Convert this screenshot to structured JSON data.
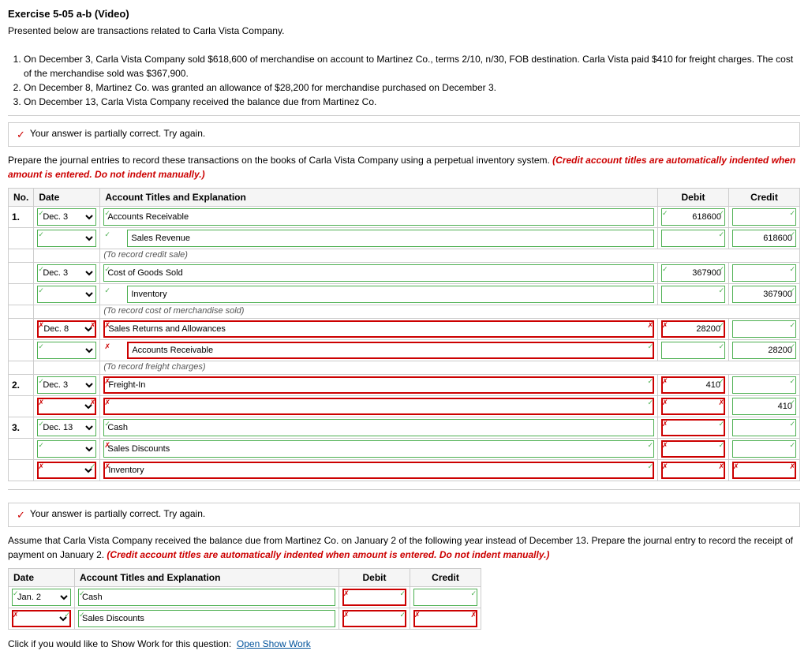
{
  "title": "Exercise 5-05 a-b (Video)",
  "intro": "Presented below are transactions related to Carla Vista Company.",
  "transactions": [
    "On December 3, Carla Vista Company sold $618,600 of merchandise on account to Martinez Co., terms 2/10, n/30, FOB destination. Carla Vista paid $410 for freight charges. The cost of the merchandise sold was $367,900.",
    "On December 8, Martinez Co. was granted an allowance of $28,200 for merchandise purchased on December 3.",
    "On December 13, Carla Vista Company received the balance due from Martinez Co."
  ],
  "alert": "Your answer is partially correct.  Try again.",
  "instruction_main": "Prepare the journal entries to record these transactions on the books of Carla Vista Company using a perpetual inventory system.",
  "instruction_red": "(Credit account titles are automatically indented when amount is entered. Do not indent manually.)",
  "table_headers": {
    "no": "No.",
    "date": "Date",
    "account": "Account Titles and Explanation",
    "debit": "Debit",
    "credit": "Credit"
  },
  "entries": [
    {
      "no": "1.",
      "rows": [
        {
          "date": "Dec. 3",
          "account": "Accounts Receivable",
          "debit": "618600",
          "credit": "",
          "date_state": "green",
          "acct_state": "green",
          "debit_state": "green",
          "credit_state": "green"
        },
        {
          "date": "",
          "account": "Sales Revenue",
          "debit": "",
          "credit": "618600",
          "acct_state": "green",
          "debit_state": "green",
          "credit_state": "green"
        },
        {
          "explanation": "(To record credit sale)"
        },
        {
          "date": "Dec. 3",
          "account": "Cost of Goods Sold",
          "debit": "367900",
          "credit": "",
          "date_state": "green",
          "acct_state": "green",
          "debit_state": "green",
          "credit_state": "green"
        },
        {
          "date": "",
          "account": "Inventory",
          "debit": "",
          "credit": "367900",
          "acct_state": "green",
          "debit_state": "green",
          "credit_state": "green"
        },
        {
          "explanation": "(To record cost of merchandise sold)"
        },
        {
          "date": "Dec. 8",
          "account": "Sales Returns and Allowances",
          "debit": "28200",
          "credit": "",
          "date_state": "red",
          "acct_state": "red",
          "debit_state": "red",
          "credit_state": "green"
        },
        {
          "date": "",
          "account": "Accounts Receivable",
          "debit": "",
          "credit": "28200",
          "acct_state": "red",
          "debit_state": "green",
          "credit_state": "green"
        },
        {
          "explanation": "(To record freight charges)"
        }
      ]
    },
    {
      "no": "2.",
      "rows": [
        {
          "date": "Dec. 3",
          "account": "Freight-In",
          "debit": "410",
          "credit": "",
          "date_state": "green",
          "acct_state": "red",
          "debit_state": "red",
          "credit_state": "green"
        },
        {
          "date": "",
          "account": "",
          "debit": "",
          "credit": "410",
          "acct_state": "red",
          "debit_state": "red",
          "credit_state": "green"
        }
      ]
    },
    {
      "no": "3.",
      "rows": [
        {
          "date": "Dec. 13",
          "account": "Cash",
          "debit": "",
          "credit": "",
          "date_state": "green",
          "acct_state": "green",
          "debit_state": "red",
          "credit_state": "green"
        },
        {
          "date": "",
          "account": "Sales Discounts",
          "debit": "",
          "credit": "",
          "acct_state": "green",
          "debit_state": "red",
          "credit_state": "green"
        },
        {
          "date": "",
          "account": "Inventory",
          "debit": "",
          "credit": "",
          "acct_state": "red",
          "debit_state": "red",
          "credit_state": "red"
        }
      ]
    }
  ],
  "section2": {
    "alert": "Your answer is partially correct.  Try again.",
    "instruction": "Assume that Carla Vista Company received the balance due from Martinez Co. on January 2 of the following year instead of December 13. Prepare the journal entry to record the receipt of payment on January 2.",
    "instruction_red": "(Credit account titles are automatically indented when amount is entered. Do not indent manually.)",
    "headers": {
      "date": "Date",
      "account": "Account Titles and Explanation",
      "debit": "Debit",
      "credit": "Credit"
    },
    "rows": [
      {
        "date": "Jan. 2",
        "account": "Cash",
        "debit": "",
        "credit": "",
        "date_state": "green",
        "acct_state": "green",
        "debit_state": "red",
        "credit_state": "green"
      },
      {
        "date": "",
        "account": "Sales Discounts",
        "debit": "",
        "credit": "",
        "acct_state": "green",
        "debit_state": "red",
        "credit_state": "red"
      }
    ]
  },
  "footer": {
    "text": "Click if you would like to Show Work for this question:",
    "link": "Open Show Work"
  }
}
